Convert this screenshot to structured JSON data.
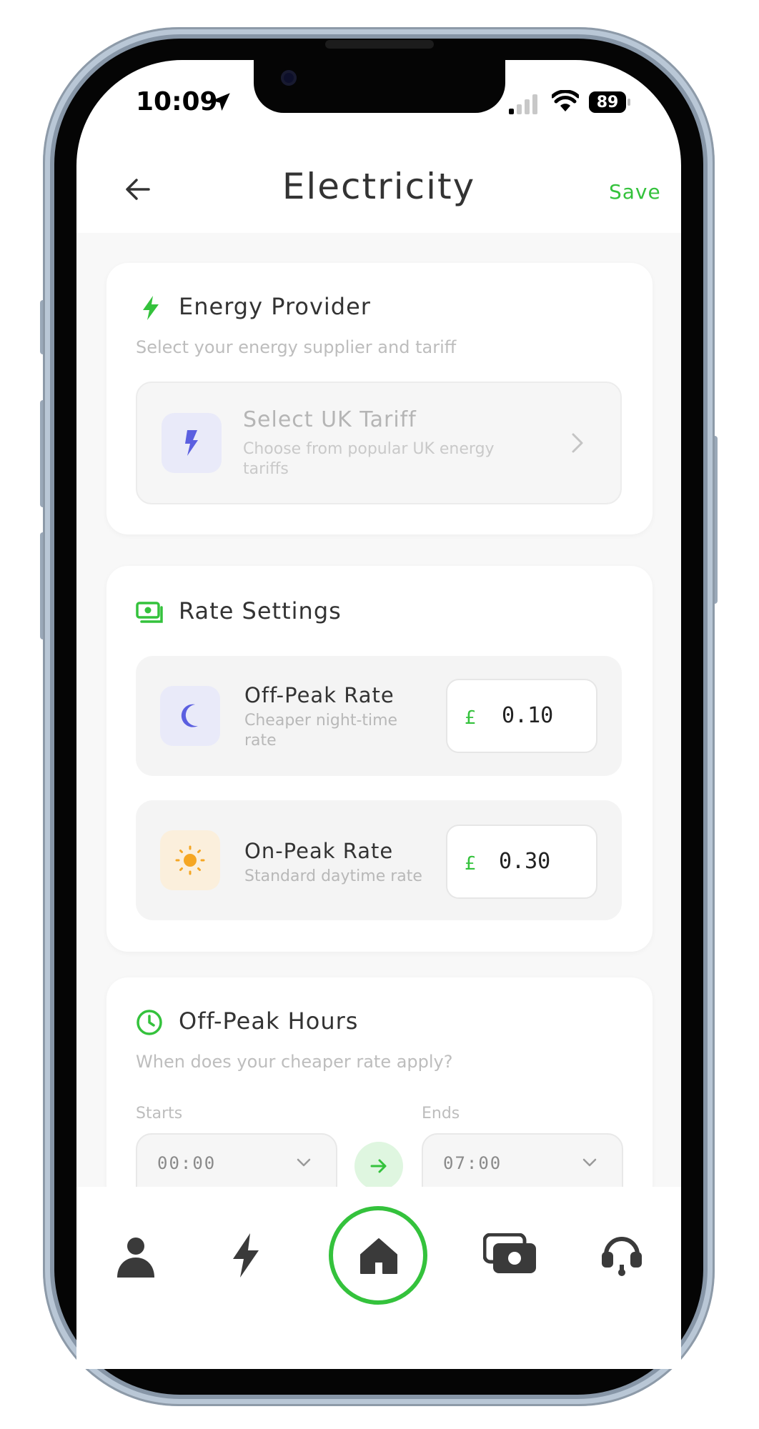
{
  "status_bar": {
    "time": "10:09",
    "battery": "89"
  },
  "header": {
    "title": "Electricity",
    "save_label": "Save"
  },
  "energy_provider": {
    "title": "Energy Provider",
    "subtitle": "Select your energy supplier and tariff",
    "tariff": {
      "title": "Select UK Tariff",
      "description_line1": "Choose from popular UK energy",
      "description_line2": "tariffs"
    }
  },
  "rate_settings": {
    "title": "Rate Settings",
    "off_peak": {
      "title": "Off-Peak Rate",
      "description_line1": "Cheaper night-time",
      "description_line2": "rate",
      "currency": "£",
      "value": "0.10"
    },
    "on_peak": {
      "title": "On-Peak Rate",
      "description": "Standard daytime rate",
      "currency": "£",
      "value": "0.30"
    }
  },
  "off_peak_hours": {
    "title": "Off-Peak Hours",
    "subtitle": "When does your cheaper rate apply?",
    "starts_label": "Starts",
    "ends_label": "Ends",
    "start_value": "00:00",
    "end_value": "07:00"
  },
  "colors": {
    "accent": "#34c23c",
    "moon": "#5b5fe0",
    "sun": "#f5a623"
  },
  "nav": {
    "active": "home"
  }
}
